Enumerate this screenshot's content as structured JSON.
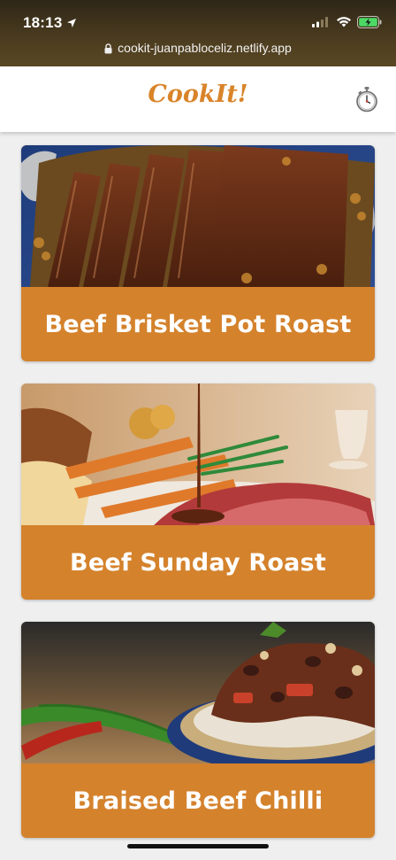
{
  "status_bar": {
    "time": "18:13"
  },
  "browser": {
    "url": "cookit-juanpabloceliz.netlify.app"
  },
  "app": {
    "name": "CookIt!"
  },
  "recipes": [
    {
      "title": "Beef Brisket Pot Roast"
    },
    {
      "title": "Beef Sunday Roast"
    },
    {
      "title": "Braised Beef Chilli"
    }
  ],
  "colors": {
    "accent": "#d4822c",
    "logo": "#d9842a",
    "background": "#efefef"
  },
  "icons": [
    "location-arrow-icon",
    "cellular-signal-icon",
    "wifi-icon",
    "battery-charging-icon",
    "lock-icon",
    "stopwatch-icon"
  ]
}
